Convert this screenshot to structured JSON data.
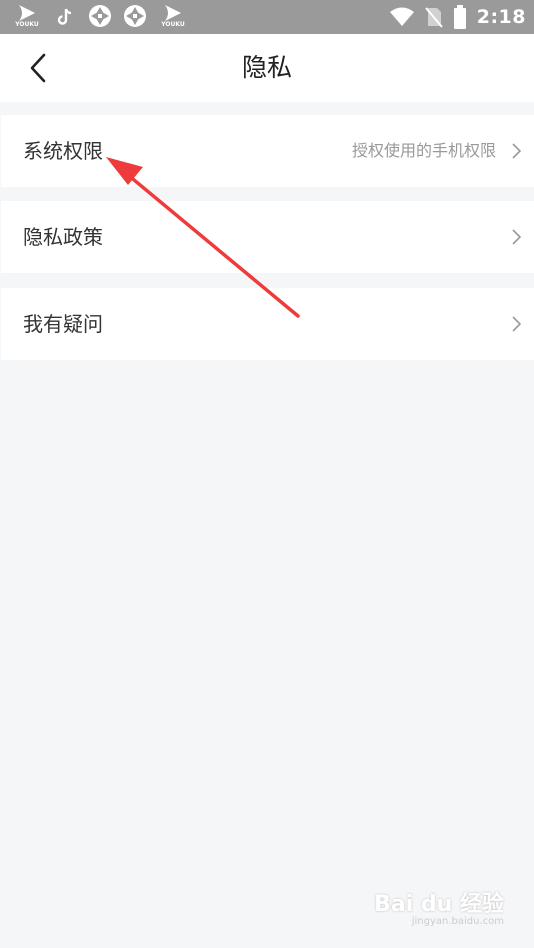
{
  "status_bar": {
    "time": "2:18",
    "left_icons": [
      "youku-icon",
      "tiktok-icon",
      "aperture-icon",
      "aperture-icon",
      "youku-icon"
    ],
    "youku_caption": "YOUKU",
    "right_icons": [
      "wifi-icon",
      "no-sim-icon",
      "battery-icon"
    ]
  },
  "header": {
    "title": "隐私",
    "back_icon": "chevron-left-icon"
  },
  "settings": {
    "items": [
      {
        "label": "系统权限",
        "hint": "授权使用的手机权限"
      },
      {
        "label": "隐私政策",
        "hint": ""
      },
      {
        "label": "我有疑问",
        "hint": ""
      }
    ]
  },
  "watermark": {
    "main": "Bai du 经验",
    "sub": "jingyan.baidu.com"
  },
  "colors": {
    "background": "#f5f6f8",
    "status_bar": "#9a9a9a",
    "annotation_arrow": "#ee3b3b"
  }
}
